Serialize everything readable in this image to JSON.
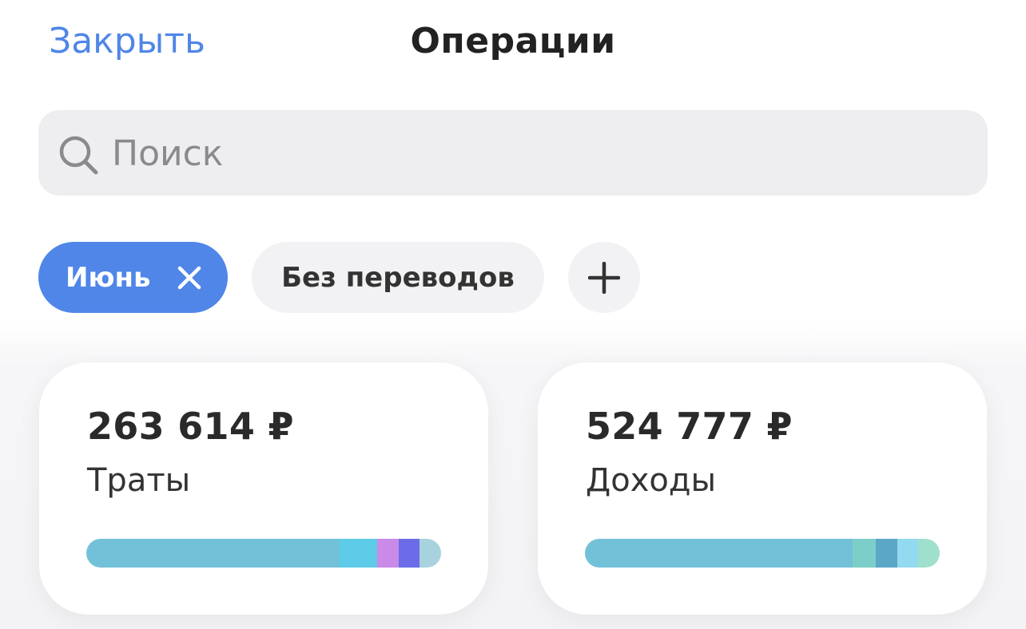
{
  "header": {
    "close_label": "Закрыть",
    "title": "Операции"
  },
  "search": {
    "placeholder": "Поиск",
    "icon": "search-icon"
  },
  "filters": {
    "month_chip": {
      "label": "Июнь",
      "active": true,
      "remove_icon": "close-icon"
    },
    "transfers_chip": {
      "label": "Без переводов"
    },
    "add_chip": {
      "icon": "plus-icon"
    }
  },
  "summary": {
    "expenses": {
      "amount": "263 614 ₽",
      "label": "Траты",
      "breakdown": [
        {
          "share": 0.715,
          "color": "#72c1d8"
        },
        {
          "share": 0.105,
          "color": "#5ecbe8"
        },
        {
          "share": 0.06,
          "color": "#c98ae8"
        },
        {
          "share": 0.06,
          "color": "#6c6ce8"
        },
        {
          "share": 0.06,
          "color": "#a8d2de"
        }
      ]
    },
    "income": {
      "amount": "524 777 ₽",
      "label": "Доходы",
      "breakdown": [
        {
          "share": 0.755,
          "color": "#72c1d8"
        },
        {
          "share": 0.065,
          "color": "#7ccfc9"
        },
        {
          "share": 0.06,
          "color": "#5aa7c7"
        },
        {
          "share": 0.06,
          "color": "#93daf0"
        },
        {
          "share": 0.06,
          "color": "#9ee0cc"
        }
      ]
    }
  },
  "colors": {
    "accent": "#4f86e8",
    "search_bg": "#eeeef0",
    "chip_bg": "#f2f2f4"
  }
}
